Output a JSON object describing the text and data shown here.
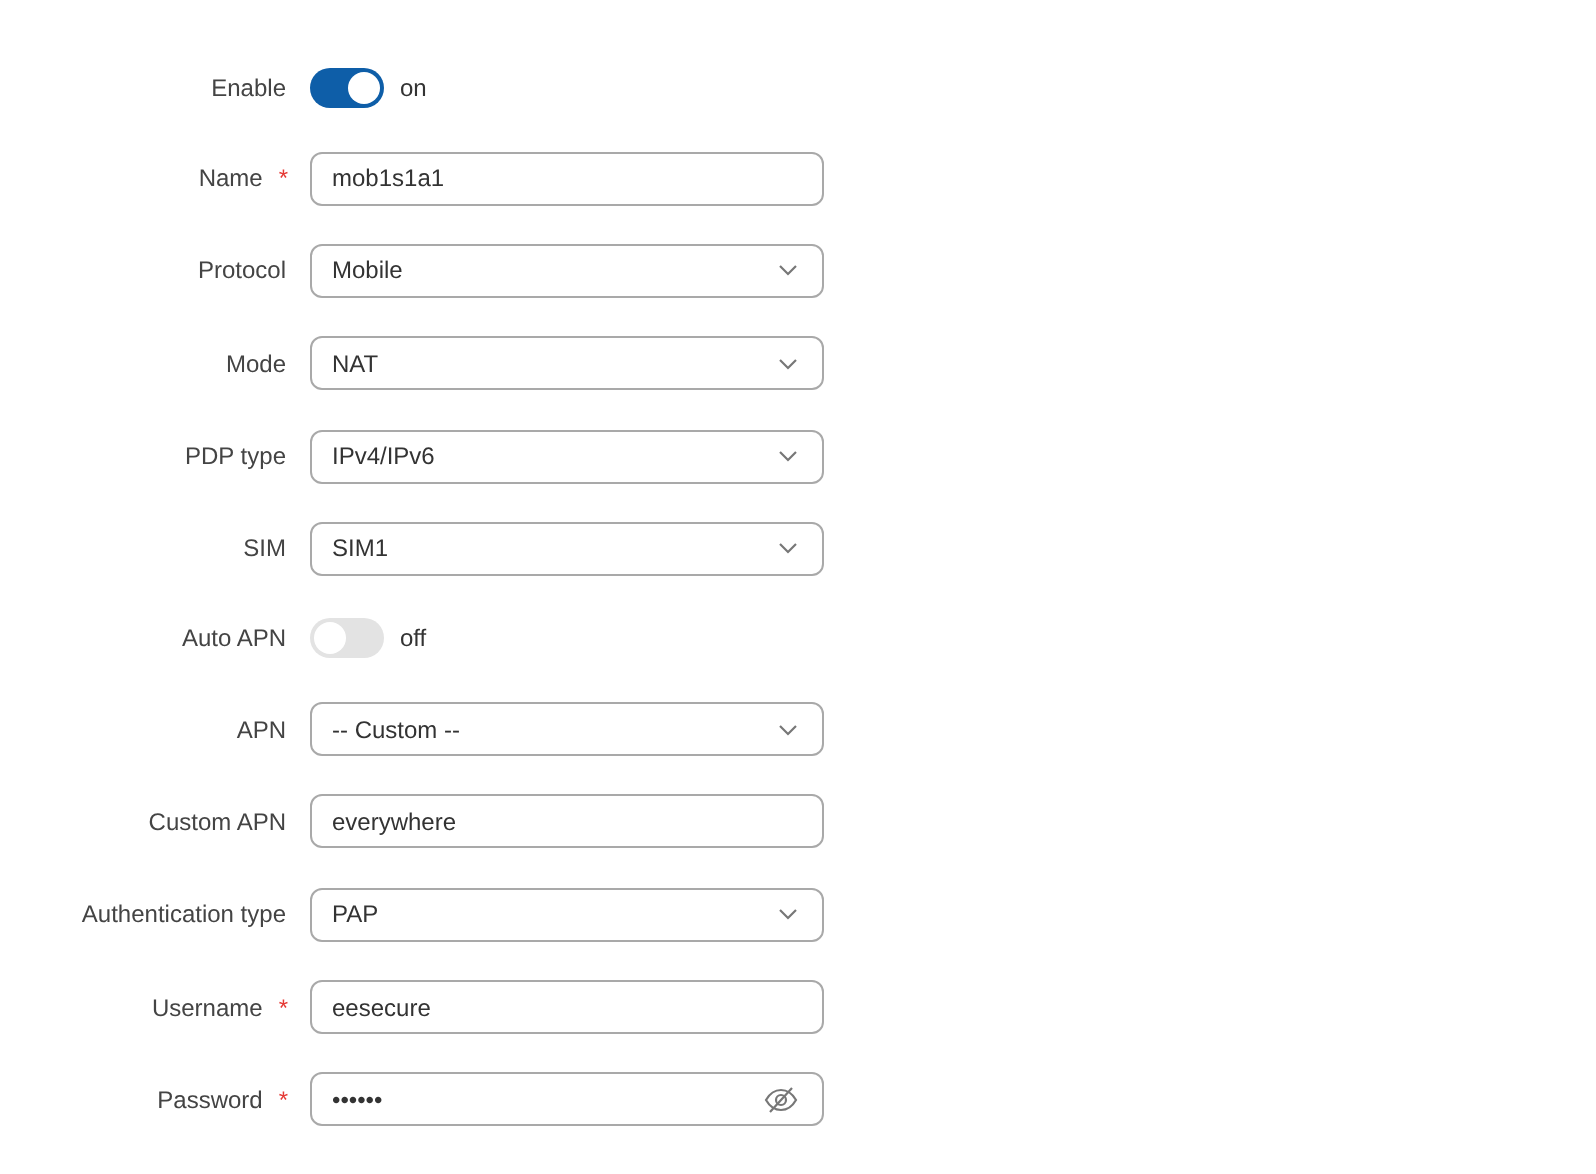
{
  "fields": [
    {
      "kind": "toggle",
      "label": "Enable",
      "on": true,
      "state_text": "on"
    },
    {
      "kind": "text",
      "label": "Name",
      "required_mark": "*",
      "value": "mob1s1a1"
    },
    {
      "kind": "select",
      "label": "Protocol",
      "value": "Mobile"
    },
    {
      "kind": "select",
      "label": "Mode",
      "value": "NAT"
    },
    {
      "kind": "select",
      "label": "PDP type",
      "value": "IPv4/IPv6"
    },
    {
      "kind": "select",
      "label": "SIM",
      "value": "SIM1"
    },
    {
      "kind": "toggle",
      "label": "Auto APN",
      "on": false,
      "state_text": "off"
    },
    {
      "kind": "select",
      "label": "APN",
      "value": "-- Custom --"
    },
    {
      "kind": "text",
      "label": "Custom APN",
      "value": "everywhere"
    },
    {
      "kind": "select",
      "label": "Authentication type",
      "value": "PAP"
    },
    {
      "kind": "text",
      "label": "Username",
      "required_mark": "*",
      "value": "eesecure"
    },
    {
      "kind": "password",
      "label": "Password",
      "required_mark": "*",
      "value": "••••••"
    }
  ]
}
